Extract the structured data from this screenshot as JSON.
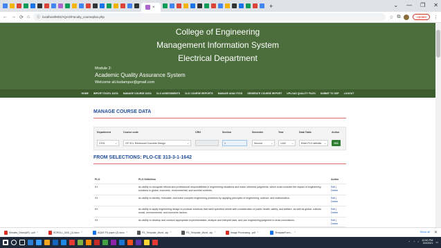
{
  "browser": {
    "tab_icon_colors": [
      "#4285f4",
      "#f4b400",
      "#db4437",
      "#0f9d58",
      "#1a73e8",
      "#333333",
      "#db4437",
      "#4285f4",
      "#aa66cc",
      "#0f9d58",
      "#f4b400",
      "#4285f4",
      "#db4437",
      "#333333",
      "#1a73e8",
      "#0f9d58",
      "#f4b400",
      "#db4437",
      "#4285f4",
      "#333333",
      "#aa66cc",
      "#0f9d58",
      "#4285f4",
      "#db4437",
      "#f4b400",
      "#1a73e8",
      "#333333",
      "#0f9d58",
      "#db4437",
      "#4285f4",
      "#f4b400",
      "#333333",
      "#1a73e8",
      "#0f9d58",
      "#db4437",
      "#4285f4"
    ],
    "active_tab_close": "×",
    "new_tab": "+",
    "window_controls": [
      "⌄",
      "—",
      "❐",
      "✕"
    ],
    "back": "←",
    "forward": "→",
    "reload": "⟳",
    "home": "⌂",
    "url": "localhost/MIS/AQAS/Faculty_courseplan.php",
    "update_label": "Update"
  },
  "header": {
    "title_line1": "College of Engineering",
    "title_line2": "Management Information System",
    "title_line3": "Electrical Department",
    "module": "Module 2:",
    "aqas": "Academic Quality Assurance System",
    "welcome": "Welcome ali.ksdampur@gmail.com",
    "nav": [
      "HOME",
      "IMPORT EXCEL DATA",
      "MANAGE COURSE DATA",
      "CLO ASSESSMENTS",
      "CLO COURSE REPORTS",
      "MANAGE ANALYTICS",
      "GENERATE COURSE REPORT",
      "UPLOAD QUALITY FILES",
      "SUBMIT TO SSP",
      "LOGOUT"
    ]
  },
  "manage": {
    "title": "MANAGE COURSE DATA",
    "headers": {
      "department": "Department",
      "course_code": "Course code",
      "crn": "CRN",
      "section": "Section",
      "semester": "Semester",
      "year": "Year",
      "data_table": "Data Table",
      "action": "Action"
    },
    "values": {
      "department": "CIVIL",
      "course_code": "CE 313- Reinforced Concrete Design",
      "crn": "",
      "section": "1",
      "semester": "Second",
      "year": "1442",
      "data_table": "Enter PLO definitio",
      "go": "GO"
    },
    "caret": "⌄"
  },
  "selections": {
    "title": "FROM SELECTIONS: PLO-CE 313-3-1-1642",
    "col_plo": "PLO",
    "col_def": "PLO Definition",
    "col_act": "Action",
    "rows": [
      {
        "plo": "K1",
        "def": "An ability to recognize ethical and professional responsibilities in engineering situations and make informed judgments, which must consider the impact of engineering solutions in global, economic, environmental, and societal contexts.",
        "edit": "Edit |",
        "delete": "Delete"
      },
      {
        "plo": "S1",
        "def": "An ability to identify, formulate, and solve complex engineering problems by applying principles of engineering, science, and mathematics.",
        "edit": "Edit |",
        "delete": "Delete"
      },
      {
        "plo": "K2",
        "def": "An ability to apply engineering design to produce solutions that meet specified needs with consideration of public health, safety, and welfare, as well as global, cultural, social, environmental, and economic factors.",
        "edit": "Edit |",
        "delete": "Delete"
      },
      {
        "plo": "S3",
        "def": "An ability to develop and conduct appropriate experimentation, analyze and interpret data, and use engineering judgment to draw conclusions.",
        "edit": "Edit |",
        "delete": "Delete"
      }
    ]
  },
  "downloads": {
    "items": [
      {
        "name": "Minutes_Dean(AR)...pdf",
        "color": "#d93025"
      },
      {
        "name": "SCROLL_SAS_(1).docx",
        "color": "#d93025"
      },
      {
        "name": "AQAS FS paper (2).docx",
        "color": "#1a73e8"
      },
      {
        "name": "FS_Template_Word...zip",
        "color": "#555555"
      },
      {
        "name": "FS_Template_Word...zip",
        "color": "#555555"
      },
      {
        "name": "Image Processing...pdf",
        "color": "#d93025"
      },
      {
        "name": "TemplateForm...",
        "color": "#1a73e8"
      }
    ],
    "show_all": "Show all",
    "close": "✕"
  },
  "taskbar": {
    "icon_colors": [
      "#ffffff",
      "#ffffff",
      "#ffffff",
      "#2d7dd2",
      "#3aa0ff",
      "#f5a623",
      "#1565c0",
      "#1e88e5",
      "#e53935",
      "#7cb342",
      "#fb8c00",
      "#c62828",
      "#43a047",
      "#8e24aa",
      "#1976d2",
      "#f4511e",
      "#5e35b1",
      "#fdd835",
      "#e53935"
    ],
    "time": "12:50 PM",
    "date": "3/4/2021"
  }
}
